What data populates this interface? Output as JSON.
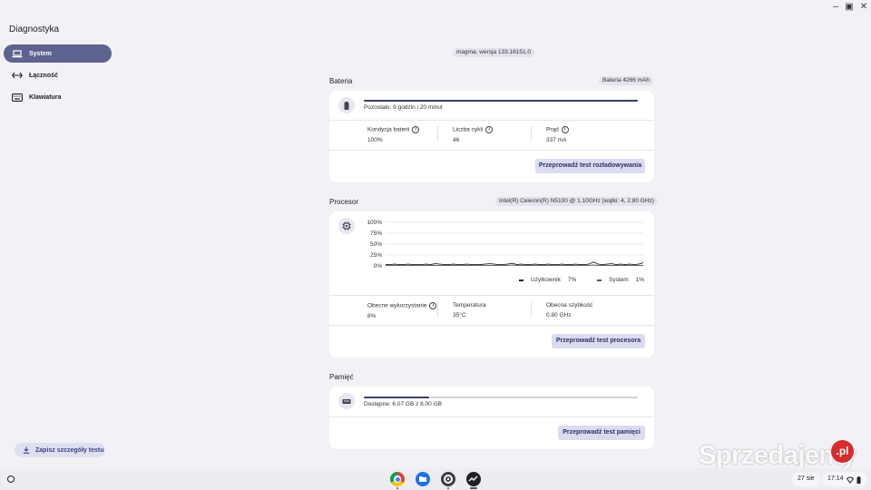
{
  "app": {
    "title": "Diagnostyka",
    "version": "magma, wersja 133.16151.0"
  },
  "window_controls": {
    "minimize": "–",
    "maximize": "▣",
    "close": "✕"
  },
  "sidebar": {
    "items": [
      {
        "label": "System",
        "icon": "laptop-icon",
        "active": true
      },
      {
        "label": "Łączność",
        "icon": "arrows-icon",
        "active": false
      },
      {
        "label": "Klawiatura",
        "icon": "keyboard-icon",
        "active": false
      }
    ],
    "save_label": "Zapisz szczegóły testu"
  },
  "battery": {
    "title": "Bateria",
    "badge": "Bateria 4266 mAh",
    "remaining": "Pozostało: 9 godzin i 20 minut",
    "level": 1.0,
    "stats": [
      {
        "label": "Kondycja baterii",
        "value": "100%"
      },
      {
        "label": "Liczba cykli",
        "value": "46"
      },
      {
        "label": "Prąd",
        "value": "337 mA"
      }
    ],
    "button": "Przeprowadź test rozładowywania"
  },
  "cpu": {
    "title": "Procesor",
    "badge": "Intel(R) Celeron(R) N5100 @ 1.10GHz (wątki: 4, 2.80 GHz)",
    "chart_data": {
      "type": "line",
      "y_ticks": [
        "100%",
        "75%",
        "50%",
        "25%",
        "0%"
      ],
      "ylim": [
        0,
        100
      ],
      "series": [
        {
          "name": "Użytkownik",
          "current": "7%",
          "values": [
            3,
            3,
            4,
            3,
            3,
            4,
            3,
            3,
            3,
            4,
            3,
            5,
            4,
            3,
            3,
            4,
            3,
            3,
            4,
            3,
            3,
            3,
            4,
            5,
            4,
            3,
            3,
            4,
            6,
            3,
            4,
            3,
            3,
            4,
            3,
            3,
            4,
            3,
            3,
            4,
            3,
            3,
            4,
            3,
            3,
            4,
            9,
            4,
            3,
            4,
            5,
            3,
            4,
            3,
            4,
            3,
            4,
            7
          ]
        },
        {
          "name": "System",
          "current": "1%",
          "values": [
            1,
            1,
            1,
            1,
            1,
            1,
            1,
            1,
            1,
            1,
            1,
            1,
            1,
            1,
            1,
            1,
            1,
            1,
            1,
            1,
            1,
            1,
            1,
            1,
            1,
            1,
            1,
            1,
            2,
            1,
            1,
            1,
            1,
            1,
            1,
            1,
            1,
            1,
            1,
            1,
            1,
            1,
            1,
            1,
            1,
            1,
            2,
            1,
            1,
            1,
            1,
            1,
            1,
            1,
            1,
            1,
            1,
            1
          ]
        }
      ]
    },
    "stats": [
      {
        "label": "Obecne wykorzystanie",
        "value": "8%"
      },
      {
        "label": "Temperatura",
        "value": "35°C"
      },
      {
        "label": "Obecna szybkość",
        "value": "0.80 GHz"
      }
    ],
    "button": "Przeprowadź test procesora"
  },
  "memory": {
    "title": "Pamięć",
    "available": "Dostępne: 6.07 GB z 8.00 GB",
    "used_fraction": 0.24,
    "button": "Przeprowadź test pamięci"
  },
  "shelf": {
    "date": "27 sie",
    "time": "17:14",
    "apps": [
      "chrome-icon",
      "files-icon",
      "settings-icon",
      "diagnostics-icon"
    ]
  },
  "watermark": {
    "text": "Sprzedajemy",
    "suffix": ".pl"
  }
}
